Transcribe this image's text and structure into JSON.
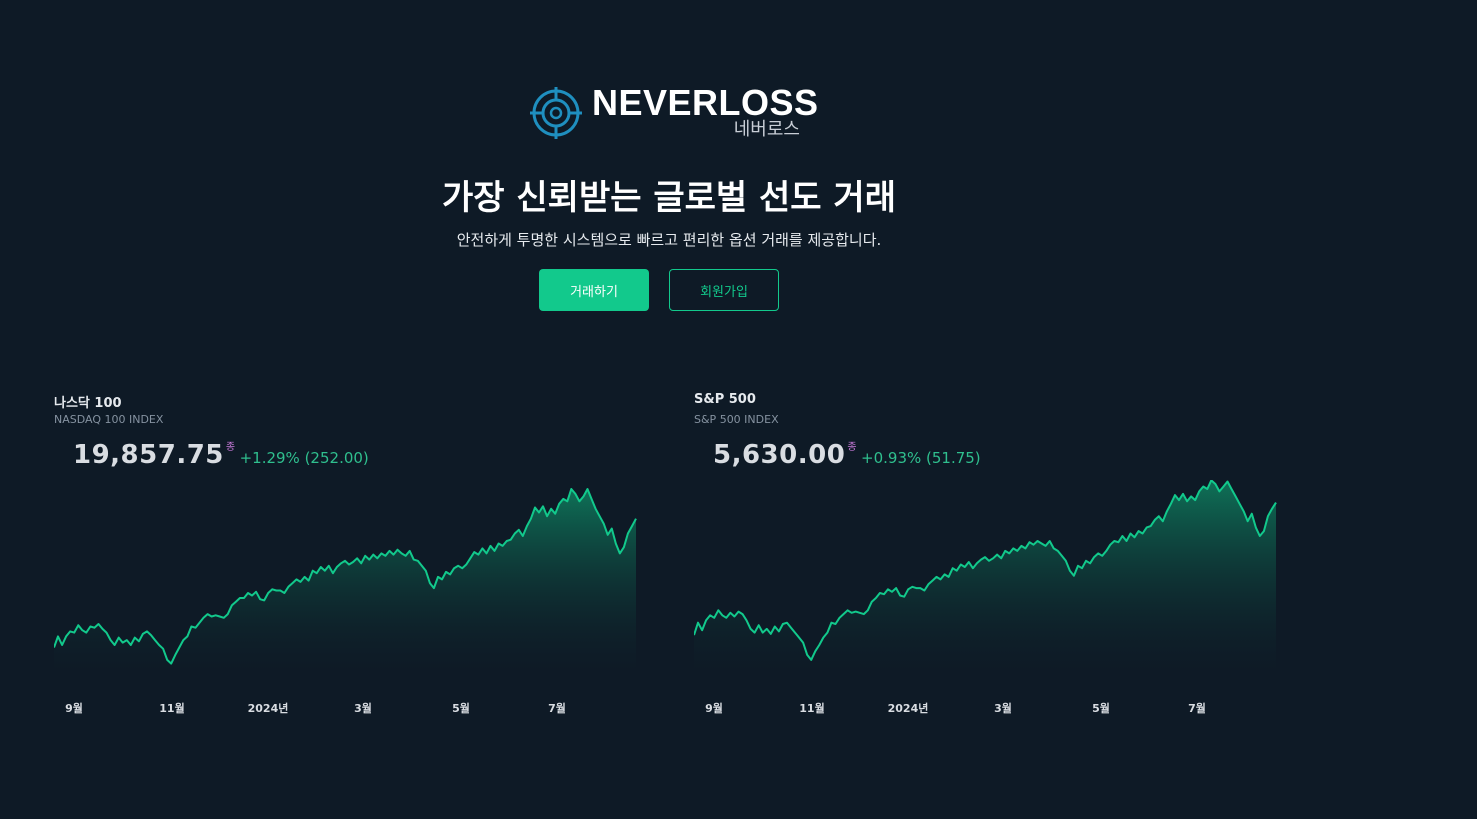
{
  "brand": {
    "name_en": "NEVERLOSS",
    "name_ko": "네버로스",
    "icon": "crosshair-target-icon",
    "accent_color": "#12c98c",
    "icon_color": "#1f8fbf"
  },
  "hero": {
    "headline": "가장 신뢰받는 글로벌 선도 거래",
    "subline": "안전하게 투명한 시스템으로 빠르고 편리한 옵션 거래를 제공합니다."
  },
  "buttons": {
    "trade": "거래하기",
    "signup": "회원가입"
  },
  "chart_data": [
    {
      "type": "area",
      "title": "나스닥 100",
      "subtitle": "NASDAQ 100 INDEX",
      "price": "19,857.75",
      "price_marker": "종",
      "change": "+1.29% (252.00)",
      "x_ticks": [
        "9월",
        "11월",
        "2024년",
        "3월",
        "5월",
        "7월"
      ],
      "line_color": "#12c98c",
      "ylim": [
        0,
        100
      ],
      "values": [
        18,
        27,
        20,
        27,
        31,
        30,
        36,
        32,
        30,
        35,
        34,
        37,
        33,
        30,
        24,
        20,
        26,
        22,
        24,
        20,
        26,
        23,
        29,
        31,
        28,
        24,
        20,
        17,
        8,
        5,
        12,
        18,
        24,
        27,
        35,
        34,
        38,
        42,
        45,
        43,
        44,
        43,
        42,
        45,
        52,
        55,
        58,
        58,
        62,
        60,
        63,
        57,
        56,
        62,
        65,
        64,
        64,
        62,
        67,
        70,
        73,
        71,
        75,
        72,
        80,
        78,
        83,
        80,
        84,
        78,
        83,
        86,
        88,
        85,
        87,
        90,
        86,
        92,
        89,
        93,
        90,
        94,
        92,
        96,
        93,
        97,
        94,
        92,
        96,
        89,
        88,
        84,
        80,
        70,
        66,
        75,
        73,
        79,
        77,
        82,
        84,
        82,
        85,
        90,
        95,
        93,
        98,
        94,
        100,
        96,
        102,
        100,
        104,
        105,
        110,
        113,
        108,
        116,
        122,
        131,
        127,
        132,
        124,
        130,
        126,
        134,
        138,
        136,
        146,
        142,
        136,
        140,
        146,
        138,
        130,
        124,
        118,
        109,
        114,
        102,
        94,
        99,
        110,
        116,
        122
      ]
    },
    {
      "type": "area",
      "title": "S&P 500",
      "subtitle": "S&P 500 INDEX",
      "price": "5,630.00",
      "price_marker": "종",
      "change": "+0.93% (51.75)",
      "x_ticks": [
        "9월",
        "11월",
        "2024년",
        "3월",
        "5월",
        "7월"
      ],
      "line_color": "#12c98c",
      "ylim": [
        0,
        100
      ],
      "values": [
        28,
        38,
        32,
        40,
        44,
        42,
        48,
        44,
        42,
        46,
        43,
        47,
        45,
        40,
        33,
        30,
        36,
        30,
        33,
        29,
        35,
        31,
        37,
        38,
        34,
        30,
        26,
        22,
        12,
        8,
        15,
        20,
        26,
        30,
        38,
        37,
        42,
        45,
        48,
        46,
        47,
        46,
        45,
        48,
        55,
        58,
        62,
        61,
        65,
        63,
        66,
        60,
        59,
        65,
        67,
        66,
        66,
        64,
        69,
        72,
        75,
        73,
        77,
        75,
        82,
        80,
        85,
        83,
        87,
        82,
        86,
        89,
        91,
        88,
        90,
        93,
        90,
        96,
        94,
        98,
        96,
        100,
        98,
        103,
        101,
        104,
        102,
        100,
        104,
        98,
        96,
        92,
        88,
        80,
        76,
        84,
        82,
        88,
        86,
        91,
        94,
        92,
        96,
        101,
        104,
        103,
        108,
        104,
        110,
        107,
        112,
        110,
        115,
        116,
        121,
        124,
        120,
        128,
        134,
        141,
        137,
        142,
        136,
        140,
        137,
        144,
        148,
        146,
        153,
        150,
        144,
        148,
        152,
        146,
        140,
        134,
        128,
        120,
        126,
        115,
        108,
        112,
        124,
        130,
        135
      ]
    }
  ]
}
